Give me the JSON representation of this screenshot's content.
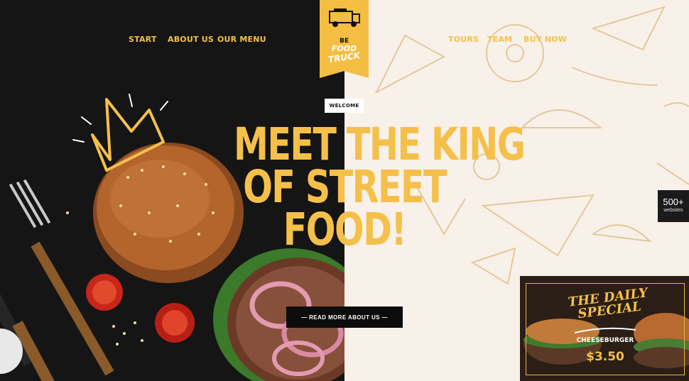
{
  "nav": {
    "left": [
      "START",
      "ABOUT US",
      "OUR MENU"
    ],
    "right": [
      "TOURS",
      "TEAM",
      "BUY NOW"
    ]
  },
  "logo": {
    "line1": "BE",
    "line2": "FOOD",
    "line3": "TRUCK"
  },
  "hero": {
    "badge": "WELCOME",
    "headline": [
      "MEET THE KING",
      "OF STREET",
      "FOOD!"
    ],
    "button": "— READ MORE ABOUT US —"
  },
  "side_badge": {
    "count": "500+",
    "label": "websites"
  },
  "daily_special": {
    "title_line1": "THE DAILY",
    "title_line2": "SPECIAL",
    "item": "CHEESEBURGER",
    "price": "$3.50"
  },
  "colors": {
    "accent": "#f5c04a",
    "dark": "#151515",
    "cream": "#f8f1ea"
  },
  "icons": [
    "crown-doodle-icon",
    "food-truck-icon",
    "fork-icon",
    "knife-icon"
  ]
}
